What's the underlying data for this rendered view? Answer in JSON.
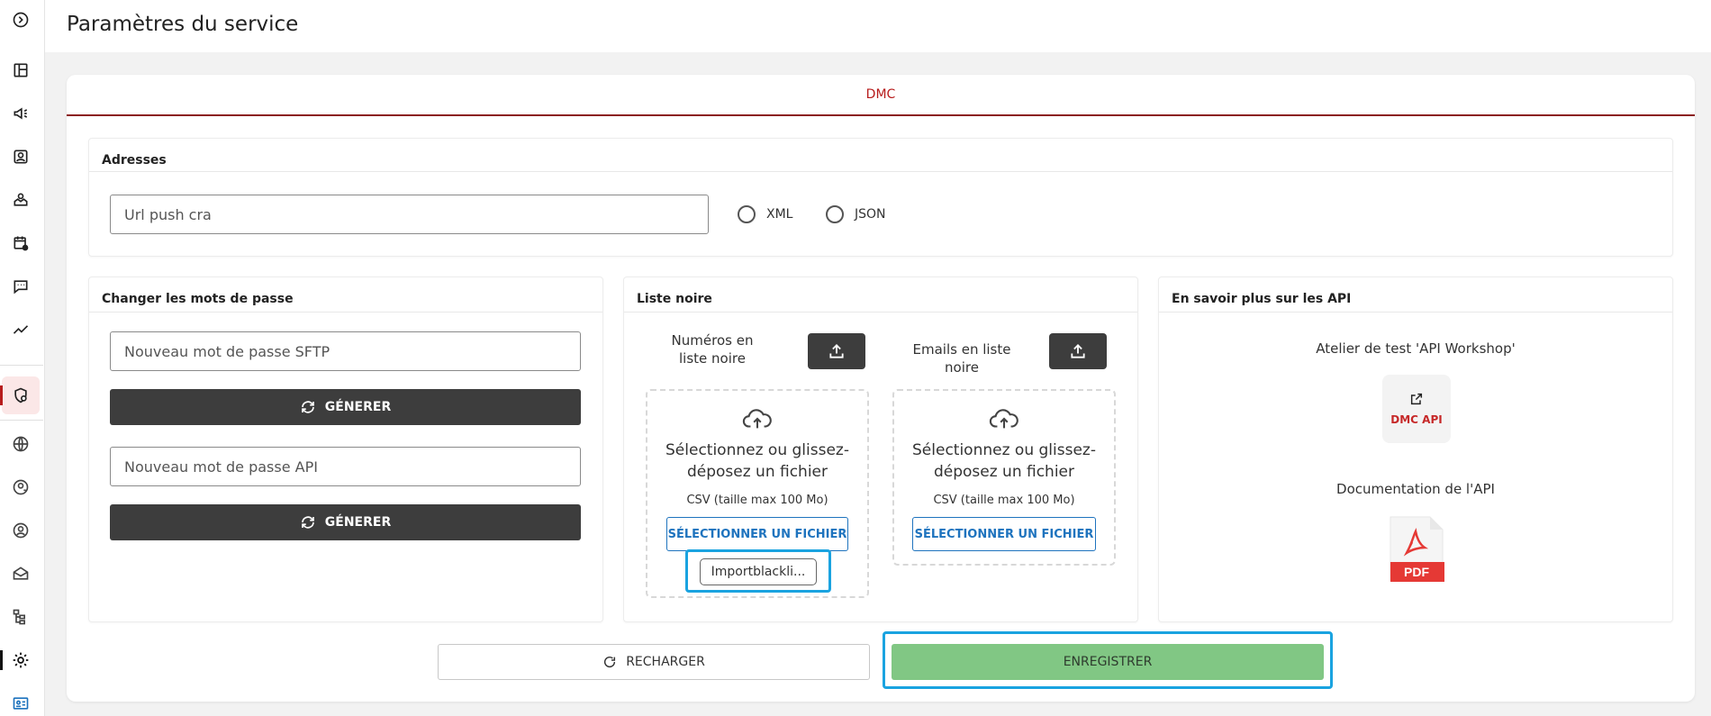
{
  "page": {
    "title": "Paramètres du service"
  },
  "tabs": [
    {
      "label": "DMC"
    }
  ],
  "addresses": {
    "title": "Adresses",
    "url_placeholder": "Url push cra",
    "format_options": [
      "XML",
      "JSON"
    ]
  },
  "passwords": {
    "title": "Changer les mots de passe",
    "sftp_placeholder": "Nouveau mot de passe SFTP",
    "api_placeholder": "Nouveau mot de passe API",
    "generate_label": "GÉNERER"
  },
  "blacklist": {
    "title": "Liste noire",
    "numbers_label": "Numéros en liste noire",
    "emails_label": "Emails en liste noire",
    "dropzone_text": "Sélectionnez ou glissez-déposez un fichier",
    "dropzone_sub": "CSV (taille max 100 Mo)",
    "select_label": "SÉLECTIONNER UN FICHIER",
    "selected_file": "Importblackli..."
  },
  "api_info": {
    "title": "En savoir plus sur les API",
    "workshop_text": "Atelier de test 'API Workshop'",
    "workshop_tile": "DMC API",
    "doc_text": "Documentation de l'API",
    "pdf_label": "PDF"
  },
  "actions": {
    "reload_label": "RECHARGER",
    "save_label": "ENREGISTRER"
  },
  "colors": {
    "brand_red": "#b71c1c",
    "save_green": "#81c784",
    "dark_button": "#3d3d3d",
    "link_blue": "#1e73be",
    "highlight": "#1aa3e0"
  },
  "sidebar_icons": [
    "expand-icon",
    "dashboard-icon",
    "campaign-icon",
    "contacts-icon",
    "inbox-icon",
    "calendar-icon",
    "chat-icon",
    "stats-icon",
    "security-settings-icon",
    "globe-icon",
    "user-circle-icon",
    "profile-icon",
    "mailbox-icon",
    "hierarchy-icon",
    "gear-icon",
    "id-card-icon"
  ]
}
